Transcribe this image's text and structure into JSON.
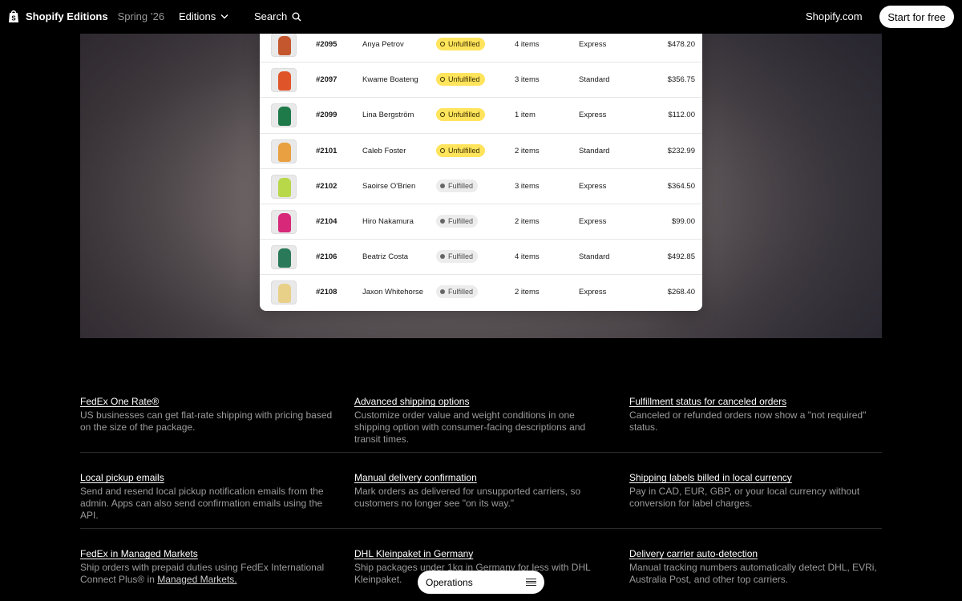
{
  "nav": {
    "brand": "Shopify Editions",
    "season": "Spring ’26",
    "editions_label": "Editions",
    "search_label": "Search",
    "site_link": "Shopify.com",
    "cta": "Start for free"
  },
  "orders": [
    {
      "number": "#2095",
      "customer": "Anya Petrov",
      "status": "Unfulfilled",
      "items": "4 items",
      "shipping": "Express",
      "total": "$478.20",
      "thumb_color": "#c4572e"
    },
    {
      "number": "#2097",
      "customer": "Kwame Boateng",
      "status": "Unfulfilled",
      "items": "3 items",
      "shipping": "Standard",
      "total": "$356.75",
      "thumb_color": "#e0542a"
    },
    {
      "number": "#2099",
      "customer": "Lina Bergström",
      "status": "Unfulfilled",
      "items": "1 item",
      "shipping": "Express",
      "total": "$112.00",
      "thumb_color": "#1f7a4a"
    },
    {
      "number": "#2101",
      "customer": "Caleb Foster",
      "status": "Unfulfilled",
      "items": "2 items",
      "shipping": "Standard",
      "total": "$232.99",
      "thumb_color": "#e8a040"
    },
    {
      "number": "#2102",
      "customer": "Saoirse O'Brien",
      "status": "Fulfilled",
      "items": "3 items",
      "shipping": "Express",
      "total": "$364.50",
      "thumb_color": "#b8d84a"
    },
    {
      "number": "#2104",
      "customer": "Hiro Nakamura",
      "status": "Fulfilled",
      "items": "2 items",
      "shipping": "Express",
      "total": "$99.00",
      "thumb_color": "#d8287a"
    },
    {
      "number": "#2106",
      "customer": "Beatriz Costa",
      "status": "Fulfilled",
      "items": "4 items",
      "shipping": "Standard",
      "total": "$492.85",
      "thumb_color": "#2a7a5a"
    },
    {
      "number": "#2108",
      "customer": "Jaxon Whitehorse",
      "status": "Fulfilled",
      "items": "2 items",
      "shipping": "Express",
      "total": "$268.40",
      "thumb_color": "#e8d088"
    }
  ],
  "features": [
    [
      {
        "title": "FedEx One Rate®",
        "desc": "US businesses can get flat-rate shipping with pricing based on the size of the package."
      },
      {
        "title": "Advanced shipping options",
        "desc": "Customize order value and weight conditions in one shipping option with consumer-facing descriptions and transit times."
      },
      {
        "title": "Fulfillment status for canceled orders",
        "desc": "Canceled or refunded orders now show a \"not required\" status."
      }
    ],
    [
      {
        "title": "Local pickup emails",
        "desc": "Send and resend local pickup notification emails from the admin. Apps can also send confirmation emails using the API."
      },
      {
        "title": "Manual delivery confirmation",
        "desc": "Mark orders as delivered for unsupported carriers, so customers no longer see \"on its way.\""
      },
      {
        "title": "Shipping labels billed in local currency",
        "desc": "Pay in CAD, EUR, GBP, or your local currency without conversion for label charges."
      }
    ],
    [
      {
        "title": "FedEx in Managed Markets",
        "desc": "Ship orders with prepaid duties using FedEx International Connect Plus® in",
        "link": "Managed Markets."
      },
      {
        "title": "DHL Kleinpaket in Germany",
        "desc": "Ship packages under 1kg in Germany for less with DHL Kleinpaket."
      },
      {
        "title": "Delivery carrier auto-detection",
        "desc": "Manual tracking numbers automatically detect DHL, EVRi, Australia Post, and other top carriers."
      }
    ]
  ],
  "floating_menu": {
    "label": "Operations"
  },
  "colors": {
    "unfulfilled": "#ffe45c",
    "fulfilled": "#ececec",
    "background": "#000000"
  }
}
